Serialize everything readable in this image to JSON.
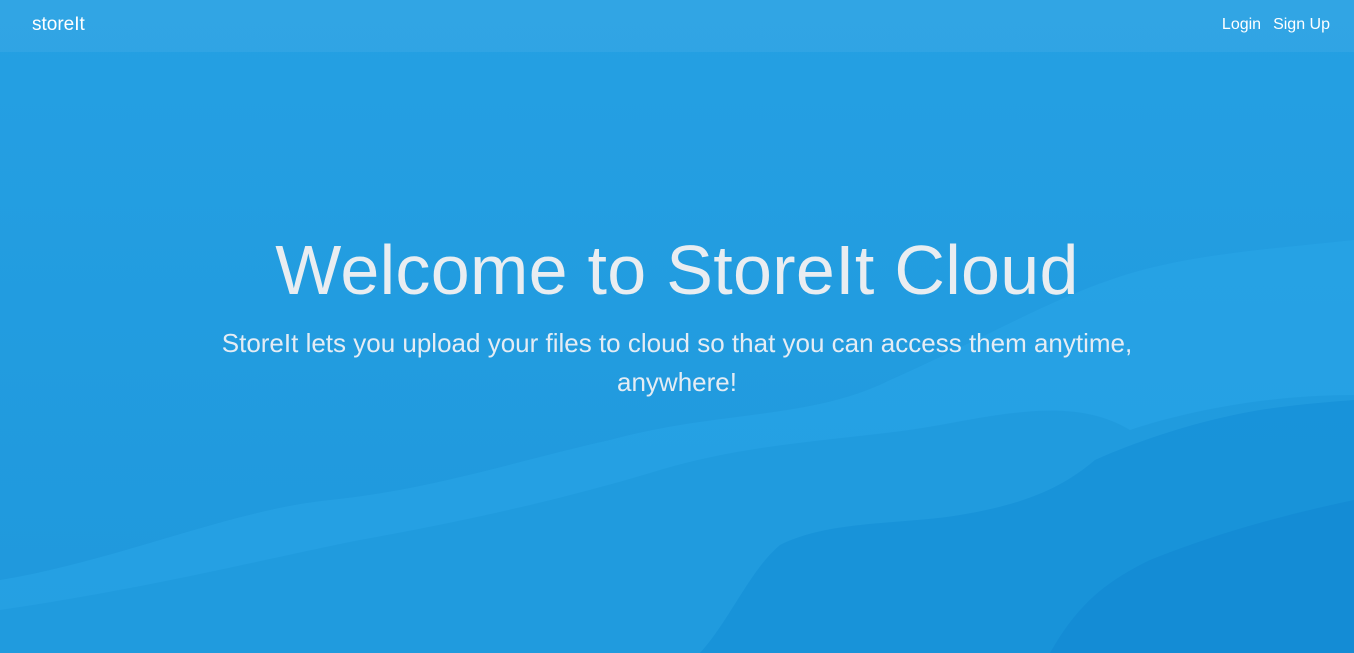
{
  "nav": {
    "brand": "storeIt",
    "links": [
      "Login",
      "Sign Up"
    ]
  },
  "hero": {
    "title": "Welcome to StoreIt Cloud",
    "subtitle": "StoreIt lets you upload your files to cloud so that you can access them anytime, anywhere!"
  },
  "colors": {
    "background": "#239fe2",
    "text_light": "#e9edf1"
  }
}
